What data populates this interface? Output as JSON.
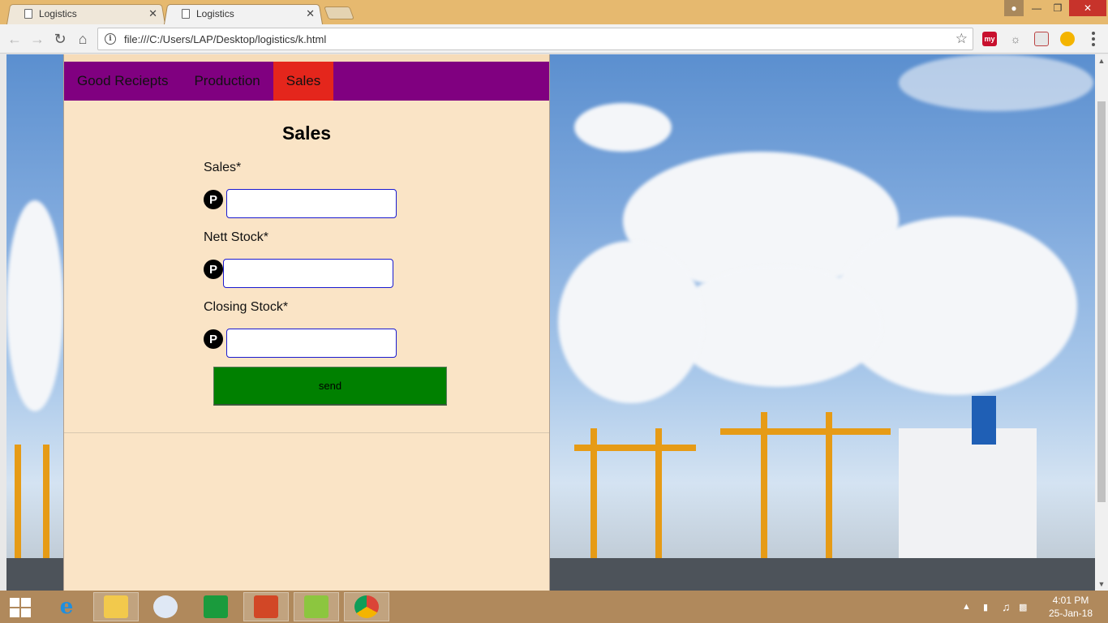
{
  "browser": {
    "tabs": [
      {
        "title": "Logistics",
        "active": false
      },
      {
        "title": "Logistics",
        "active": true
      }
    ],
    "url": "file:///C:/Users/LAP/Desktop/logistics/k.html",
    "extensions": [
      "my"
    ]
  },
  "page": {
    "nav": [
      {
        "label": "Good Reciepts",
        "active": false
      },
      {
        "label": "Production",
        "active": false
      },
      {
        "label": "Sales",
        "active": true
      }
    ],
    "form": {
      "title": "Sales",
      "fields": [
        {
          "label": "Sales*",
          "icon_text": "P",
          "value": ""
        },
        {
          "label": "Nett Stock*",
          "icon_text": "P",
          "value": ""
        },
        {
          "label": "Closing Stock*",
          "icon_text": "P",
          "value": ""
        }
      ],
      "submit_label": "send"
    },
    "colors": {
      "nav_bg": "#800080",
      "nav_active": "#e4261c",
      "panel_bg": "#fae4c6",
      "button_bg": "#008000"
    }
  },
  "taskbar": {
    "time": "4:01 PM",
    "date": "25-Jan-18"
  }
}
